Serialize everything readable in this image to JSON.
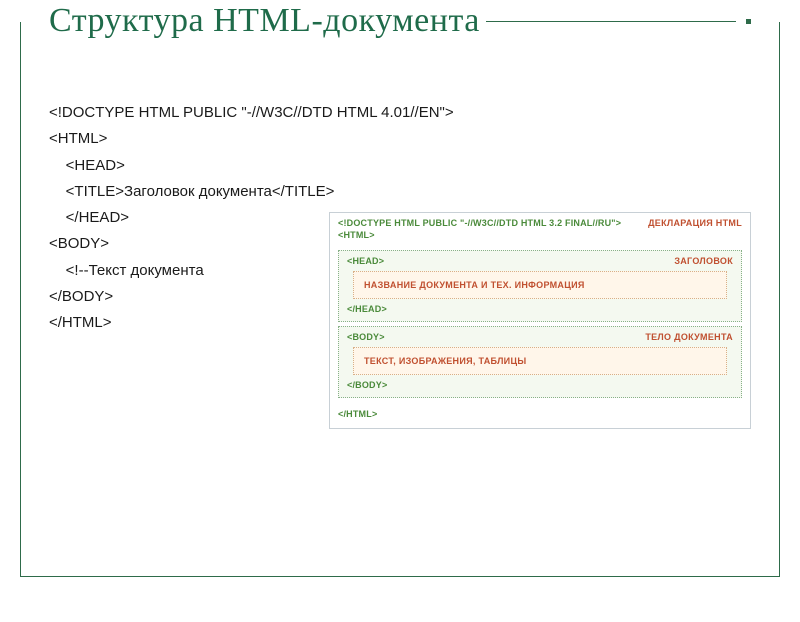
{
  "title": "Структура HTML-документа",
  "code": {
    "l1": "<!DOCTYPE HTML PUBLIC \"-//W3C//DTD HTML 4.01//EN\">",
    "l2": "<HTML>",
    "l3": "    <HEAD>",
    "l4": "    <TITLE>Заголовок документа</TITLE>",
    "l5": "    </HEAD>",
    "l6": "<BODY>",
    "l7": "    <!--Текст документа",
    "l8": "</BODY>",
    "l9": "</HTML>"
  },
  "diagram": {
    "doctype": "<!DOCTYPE HTML PUBLIC \"-//W3C//DTD HTML 3.2 FINAL//RU\">",
    "html_open": "<HTML>",
    "decl_label": "ДЕКЛАРАЦИЯ HTML",
    "head_open": "<HEAD>",
    "head_label": "ЗАГОЛОВОК",
    "head_inner": "НАЗВАНИЕ ДОКУМЕНТА И ТЕХ. ИНФОРМАЦИЯ",
    "head_close": "</HEAD>",
    "body_open": "<BODY>",
    "body_label": "ТЕЛО ДОКУМЕНТА",
    "body_inner": "ТЕКСТ, ИЗОБРАЖЕНИЯ, ТАБЛИЦЫ",
    "body_close": "</BODY>",
    "html_close": "</HTML>"
  }
}
